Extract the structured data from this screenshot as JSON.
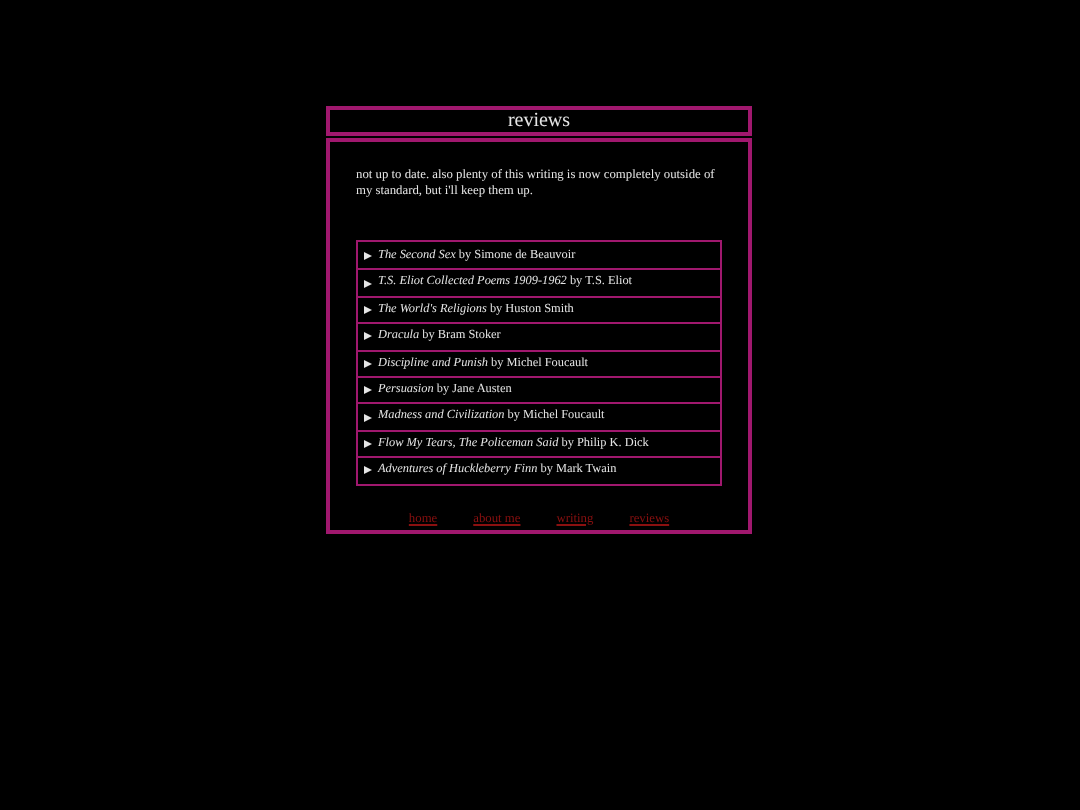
{
  "header": {
    "title": "reviews"
  },
  "intro": "not up to date. also plenty of this writing is now completely outside of my standard, but i'll keep them up.",
  "reviews": [
    {
      "label": "*The Second Sex* by Simone de Beauvoir",
      "expanded": false
    },
    {
      "label": "*T.S. Eliot Collected Poems 1909-1962* by T.S. Eliot",
      "expanded": false
    },
    {
      "label": "*The World's Religions* by Huston Smith",
      "expanded": false
    },
    {
      "label": "*Dracula* by Bram Stoker",
      "expanded": false
    },
    {
      "label": "*Discipline and Punish* by Michel Foucault",
      "expanded": false
    },
    {
      "label": "*Persuasion* by Jane Austen",
      "expanded": false
    },
    {
      "label": "*Madness and Civilization* by Michel Foucault",
      "expanded": false
    },
    {
      "label": "*Flow My Tears, The Policeman Said* by Philip K. Dick",
      "expanded": false
    },
    {
      "label": "*Adventures of Huckleberry Finn* by Mark Twain",
      "expanded": false
    }
  ],
  "nav": [
    "home",
    "about me",
    "writing",
    "reviews"
  ]
}
